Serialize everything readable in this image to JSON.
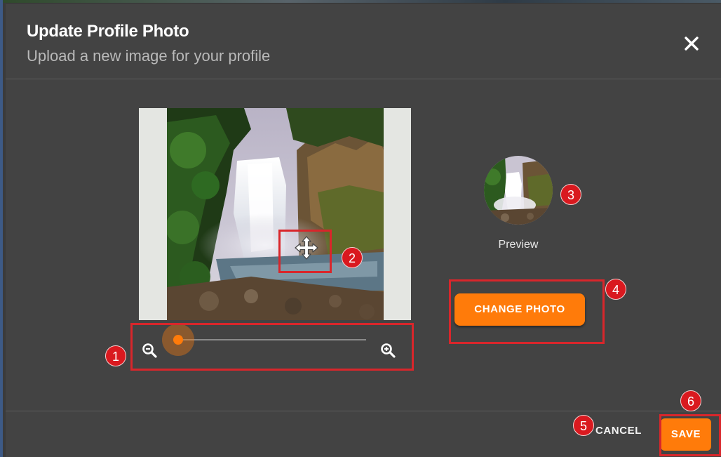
{
  "dialog": {
    "title": "Update Profile Photo",
    "subtitle": "Upload a new image for your profile"
  },
  "icons": {
    "close": "close-icon",
    "zoom_out": "zoom-out-icon",
    "zoom_in": "zoom-in-icon",
    "move": "move-arrows-icon"
  },
  "zoom_slider": {
    "value_fraction": 0.0
  },
  "preview": {
    "label": "Preview"
  },
  "actions": {
    "change_photo": "CHANGE PHOTO",
    "cancel": "CANCEL",
    "save": "SAVE"
  },
  "annotations": [
    "1",
    "2",
    "3",
    "4",
    "5",
    "6"
  ],
  "colors": {
    "accent": "#ff7b0a",
    "annotation": "#d9262b",
    "dialog_bg": "#434343"
  }
}
